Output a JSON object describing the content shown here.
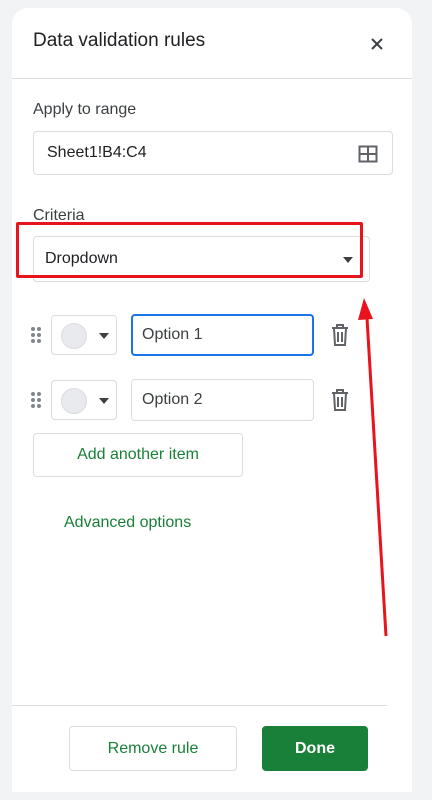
{
  "header": {
    "title": "Data validation rules",
    "close_icon": "close-icon"
  },
  "range": {
    "label": "Apply to range",
    "value": "Sheet1!B4:C4",
    "icon": "select-range-grid-icon"
  },
  "criteria": {
    "label": "Criteria",
    "selected": "Dropdown"
  },
  "items": [
    {
      "value": "Option 1",
      "color": "#e8eaed",
      "focused": true
    },
    {
      "value": "Option 2",
      "color": "#e8eaed",
      "focused": false
    }
  ],
  "add_item_label": "Add another item",
  "advanced_options_label": "Advanced options",
  "footer": {
    "remove_label": "Remove rule",
    "done_label": "Done"
  },
  "colors": {
    "accent_green": "#188038",
    "focus_blue": "#1a73e8",
    "annotation_red": "#e8141c"
  }
}
